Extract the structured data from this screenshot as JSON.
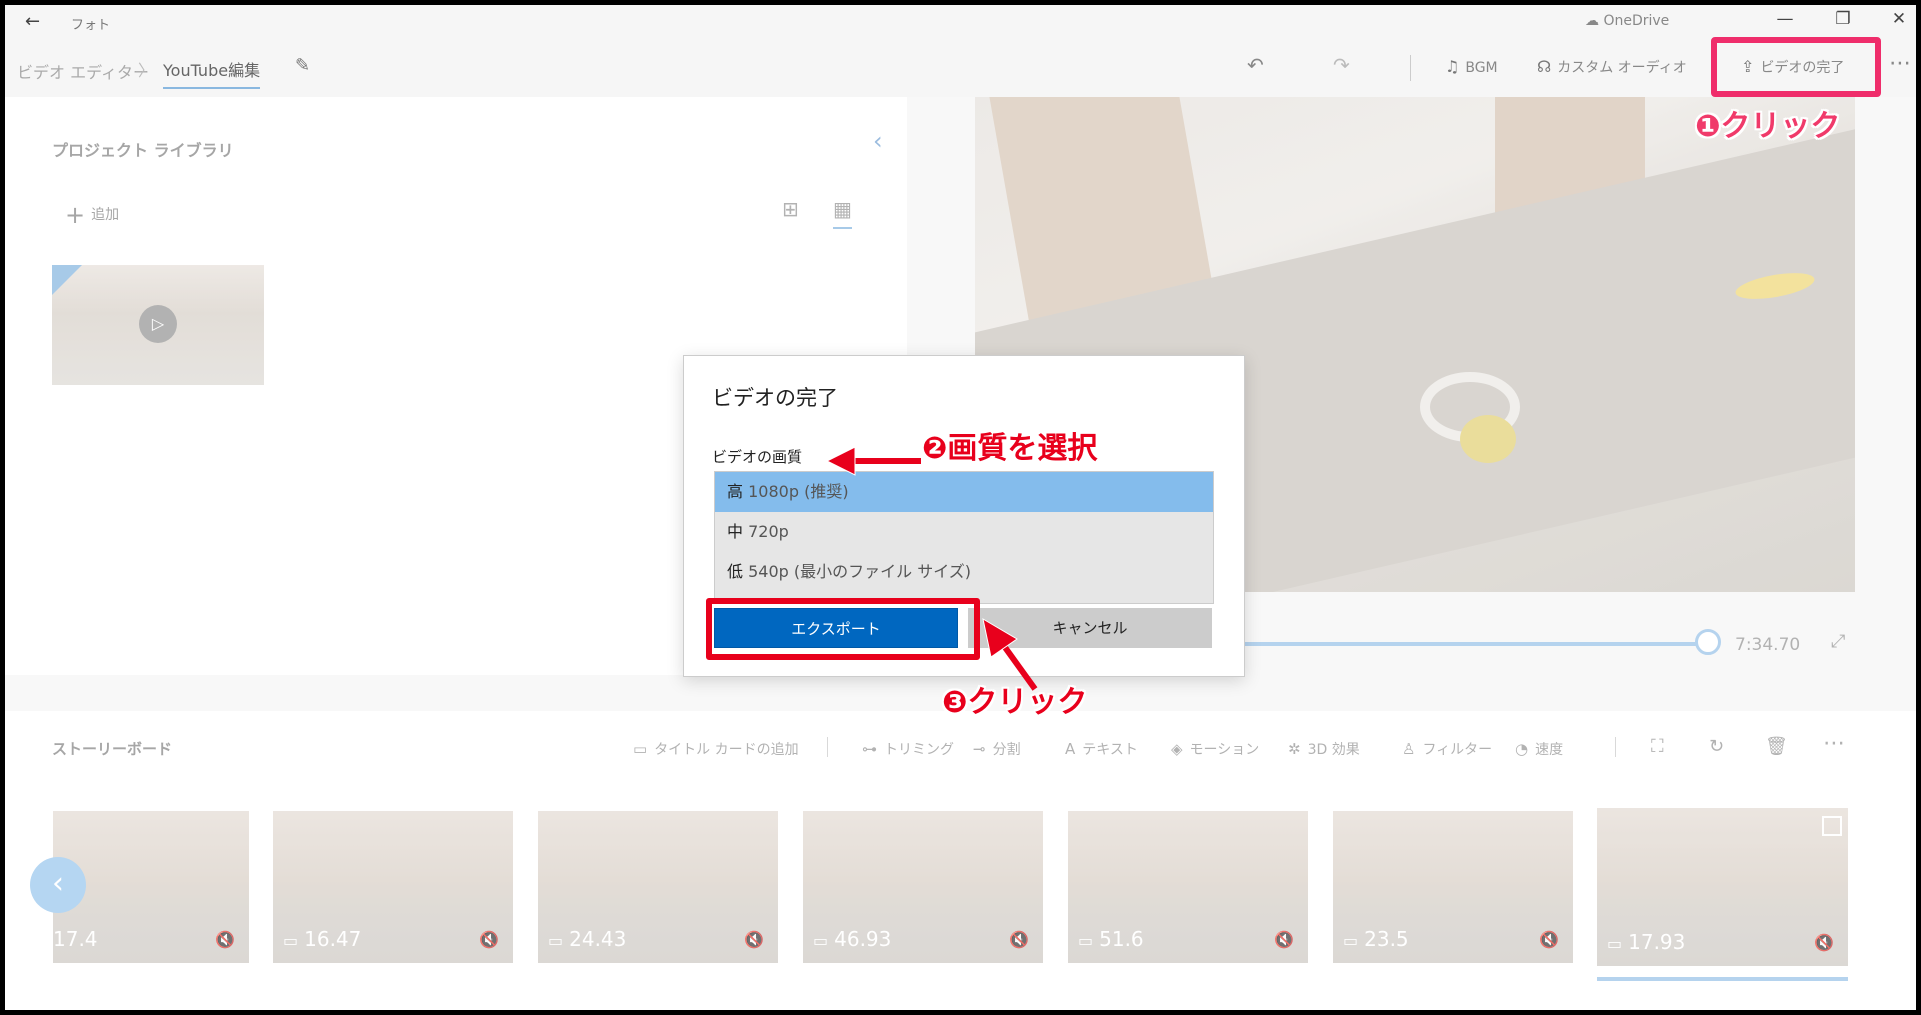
{
  "titlebar": {
    "back_icon": "←",
    "app_name": "フォト",
    "onedrive": "OneDrive",
    "minimize": "—",
    "restore": "❐",
    "close": "✕"
  },
  "breadcrumb": {
    "parent": "ビデオ エディター",
    "separator": "〉",
    "current": "YouTube編集"
  },
  "toolbar": {
    "undo_icon": "↶",
    "redo_icon": "↷",
    "bgm_label": "BGM",
    "custom_audio_label": "カスタム オーディオ",
    "finish_label": "ビデオの完了",
    "more": "⋯"
  },
  "library": {
    "title": "プロジェクト ライブラリ",
    "add_label": "追加"
  },
  "player": {
    "time": "7:34.70"
  },
  "storyboard": {
    "title": "ストーリーボード",
    "tools": {
      "title_card": "タイトル カードの追加",
      "trim": "トリミング",
      "split": "分割",
      "text": "テキスト",
      "motion": "モーション",
      "effects_3d": "3D 効果",
      "filter": "フィルター",
      "speed": "速度"
    },
    "clips": [
      {
        "duration": "17.4"
      },
      {
        "duration": "16.47"
      },
      {
        "duration": "24.43"
      },
      {
        "duration": "46.93"
      },
      {
        "duration": "51.6"
      },
      {
        "duration": "23.5"
      },
      {
        "duration": "17.93"
      }
    ]
  },
  "dialog": {
    "title": "ビデオの完了",
    "quality_label": "ビデオの画質",
    "options": [
      {
        "level": "高",
        "detail": "1080p (推奨)",
        "selected": true
      },
      {
        "level": "中",
        "detail": "720p",
        "selected": false
      },
      {
        "level": "低",
        "detail": "540p (最小のファイル サイズ)",
        "selected": false
      }
    ],
    "export_label": "エクスポート",
    "cancel_label": "キャンセル"
  },
  "annotations": {
    "step1": "❶クリック",
    "step2": "❷画質を選択",
    "step3": "❸クリック",
    "color_pink": "#ef2d6b",
    "color_red": "#e8001c"
  }
}
